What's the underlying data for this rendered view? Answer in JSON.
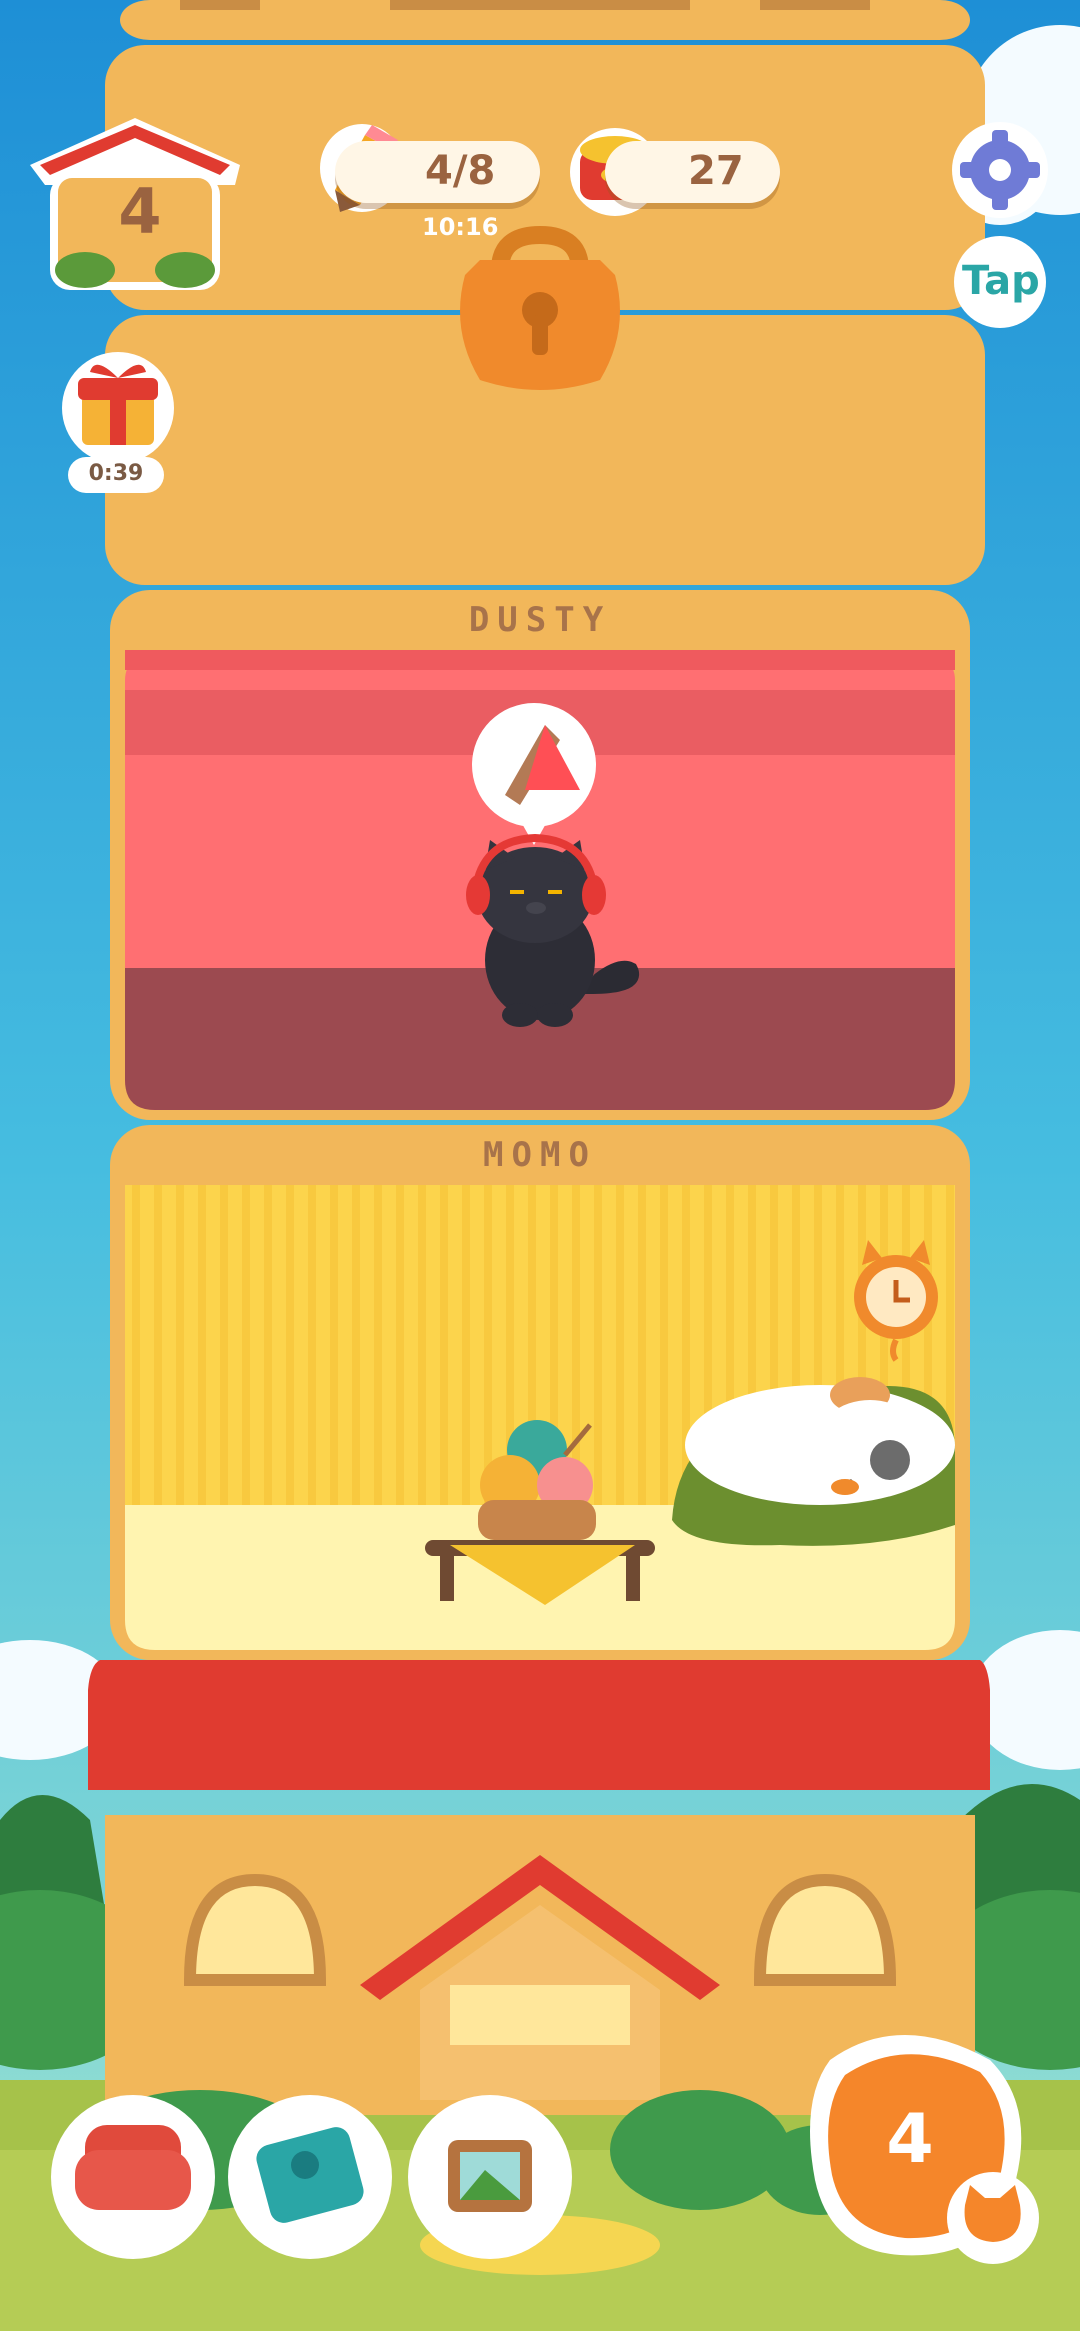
{
  "hud": {
    "tower_level": "4",
    "pencils": "4/8",
    "pencil_timer": "10:16",
    "cans": "27",
    "gift_timer": "0:39",
    "tap_label": "Tap",
    "level_badge": "4"
  },
  "rooms": [
    {
      "name": "DUSTY"
    },
    {
      "name": "MOMO"
    }
  ],
  "icons": {
    "settings": "gear-icon",
    "pencil": "pencil-icon",
    "can": "cat-food-can-icon",
    "gift": "gift-icon",
    "lock": "padlock-icon",
    "furniture": "armchair-icon",
    "catalog": "paw-book-icon",
    "photos": "picture-frame-icon"
  },
  "colors": {
    "sky_top": "#1e8fd6",
    "sky_bottom": "#7fd8d0",
    "tower": "#f2b75a",
    "dusty_wall": "#ff6f72",
    "dusty_floor": "#9c4a50",
    "momo_wall": "#fcd44c",
    "momo_floor": "#fff4b0",
    "roof": "#e03b30"
  }
}
